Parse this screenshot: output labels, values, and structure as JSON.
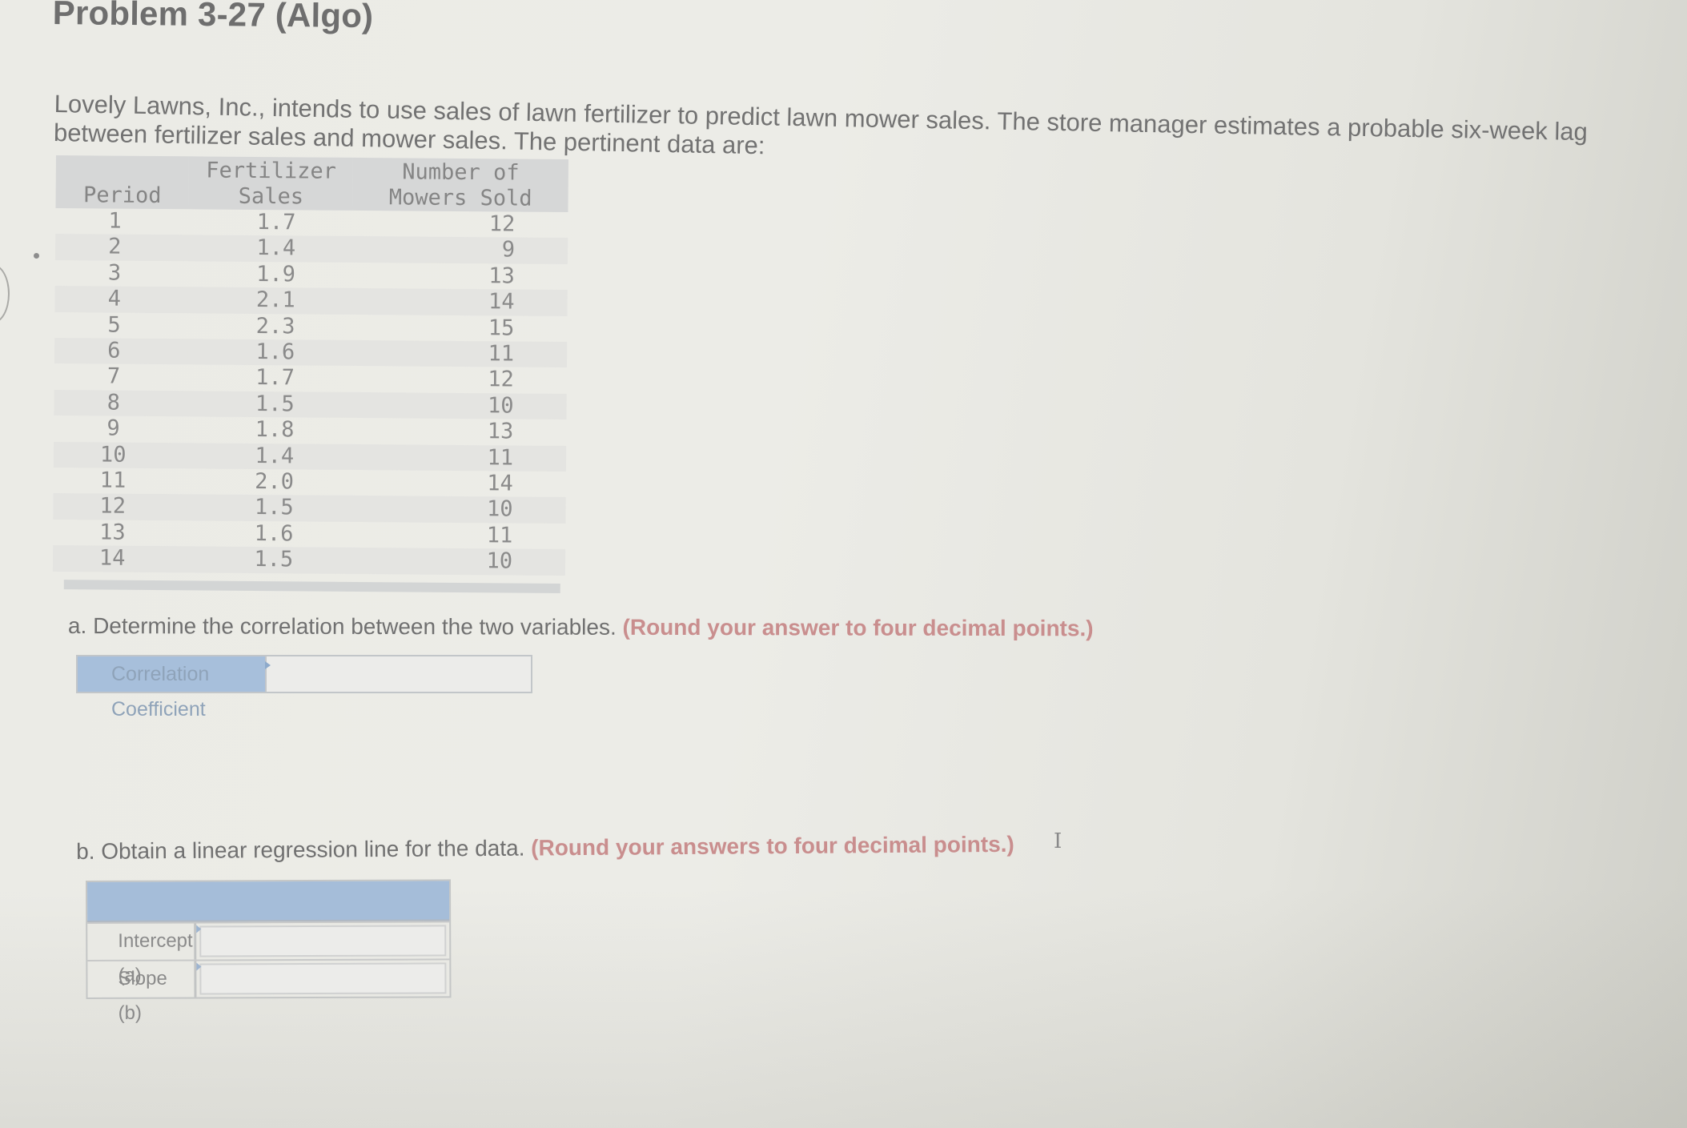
{
  "page": {
    "title": "Problem 3-27 (Algo)",
    "intro": "Lovely Lawns, Inc., intends to use sales of lawn fertilizer to predict lawn mower sales. The store manager estimates a probable six-week lag between fertilizer sales and mower sales. The pertinent data are:"
  },
  "data_table": {
    "headers": {
      "period": "Period",
      "fertilizer_line1": "Fertilizer",
      "fertilizer_line2": "Sales",
      "mowers_line1": "Number of",
      "mowers_line2": "Mowers Sold"
    },
    "rows": [
      {
        "period": "1",
        "fertilizer": "1.7",
        "mowers": "12"
      },
      {
        "period": "2",
        "fertilizer": "1.4",
        "mowers": "9"
      },
      {
        "period": "3",
        "fertilizer": "1.9",
        "mowers": "13"
      },
      {
        "period": "4",
        "fertilizer": "2.1",
        "mowers": "14"
      },
      {
        "period": "5",
        "fertilizer": "2.3",
        "mowers": "15"
      },
      {
        "period": "6",
        "fertilizer": "1.6",
        "mowers": "11"
      },
      {
        "period": "7",
        "fertilizer": "1.7",
        "mowers": "12"
      },
      {
        "period": "8",
        "fertilizer": "1.5",
        "mowers": "10"
      },
      {
        "period": "9",
        "fertilizer": "1.8",
        "mowers": "13"
      },
      {
        "period": "10",
        "fertilizer": "1.4",
        "mowers": "11"
      },
      {
        "period": "11",
        "fertilizer": "2.0",
        "mowers": "14"
      },
      {
        "period": "12",
        "fertilizer": "1.5",
        "mowers": "10"
      },
      {
        "period": "13",
        "fertilizer": "1.6",
        "mowers": "11"
      },
      {
        "period": "14",
        "fertilizer": "1.5",
        "mowers": "10"
      }
    ]
  },
  "part_a": {
    "question": "a. Determine the correlation between the two variables.",
    "hint": "(Round your answer to four decimal points.)",
    "field_label": "Correlation Coefficient",
    "field_value": ""
  },
  "part_b": {
    "question": "b. Obtain a linear regression line for the data.",
    "hint": "(Round your answers to four decimal points.)",
    "rows": [
      {
        "label": "Intercept (a)",
        "value": ""
      },
      {
        "label": "Slope (b)",
        "value": ""
      }
    ]
  },
  "colors": {
    "hint_red": "#c98e8e",
    "label_blue": "#a7bfdb",
    "table_header_gray": "#d6d7d7"
  }
}
